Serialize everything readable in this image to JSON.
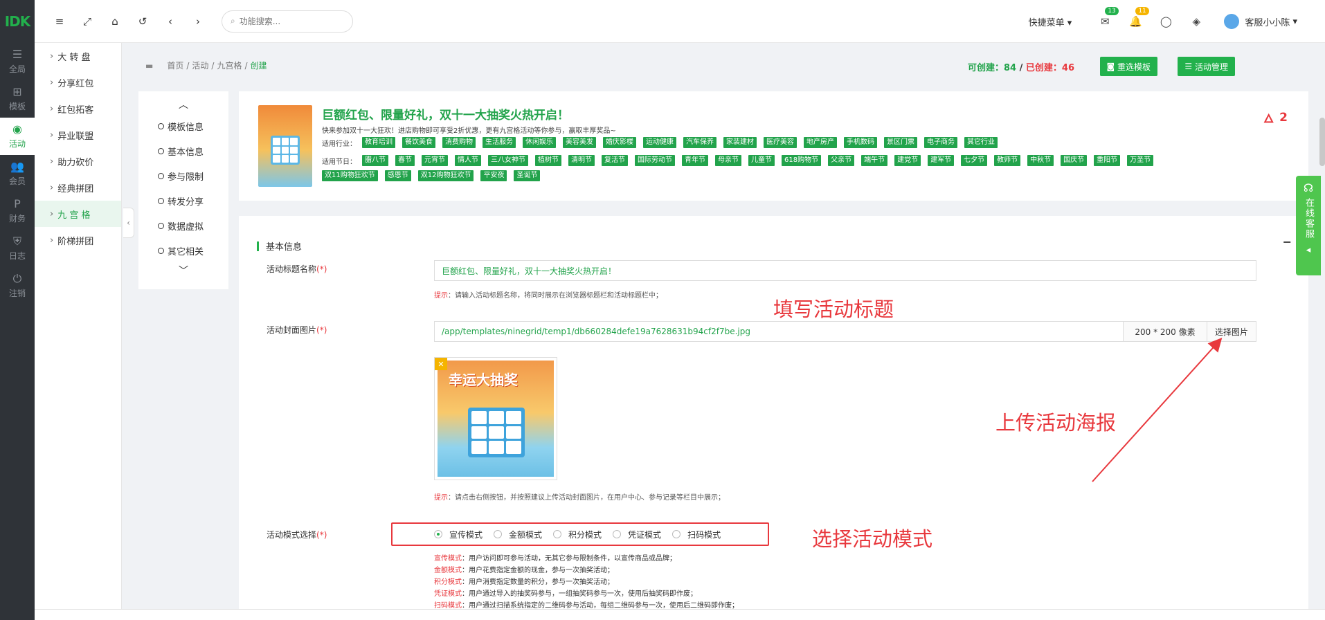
{
  "logo": "IDK",
  "rail": [
    {
      "label": "全局",
      "icon": "sliders-icon"
    },
    {
      "label": "模板",
      "icon": "sitemap-icon"
    },
    {
      "label": "活动",
      "icon": "map-pin-icon",
      "active": true
    },
    {
      "label": "会员",
      "icon": "users-icon"
    },
    {
      "label": "财务",
      "icon": "paypal-icon"
    },
    {
      "label": "日志",
      "icon": "shield-icon"
    },
    {
      "label": "注销",
      "icon": "power-icon"
    }
  ],
  "submenu": [
    "大 转 盘",
    "分享红包",
    "红包拓客",
    "异业联盟",
    "助力砍价",
    "经典拼团",
    "九 宫 格",
    "阶梯拼团"
  ],
  "submenu_active": "九 宫 格",
  "search_placeholder": "功能搜索...",
  "quick_menu": "快捷菜单",
  "mail_badge": "13",
  "bell_badge": "11",
  "username": "客服小小陈",
  "breadcrumb": {
    "home": "首页",
    "activity": "活动",
    "ninegrid": "九宫格",
    "current": "创建"
  },
  "stats": {
    "can_label": "可创建：",
    "can_value": "84",
    "sep": " / ",
    "made_label": "已创建：",
    "made_value": "46"
  },
  "buttons": {
    "reselect": "重选模板",
    "manage": "活动管理"
  },
  "section_nav": [
    "模板信息",
    "基本信息",
    "参与限制",
    "转发分享",
    "数据虚拟",
    "其它相关"
  ],
  "template": {
    "title": "巨额红包、限量好礼，双十一大抽奖火热开启！",
    "desc": "快来参加双十一大狂欢！进店购物即可享受2折优惠，更有九宫格活动等你参与，赢取丰厚奖品~",
    "industry_label": "适用行业：",
    "industries": [
      "教育培训",
      "餐饮美食",
      "消费购物",
      "生活服务",
      "休闲娱乐",
      "美容美发",
      "婚庆影楼",
      "运动健康",
      "汽车保养",
      "家装建材",
      "医疗美容",
      "地产房产",
      "手机数码",
      "景区门票",
      "电子商务",
      "其它行业"
    ],
    "festival_label": "适用节日：",
    "festivals": [
      "腊八节",
      "春节",
      "元宵节",
      "情人节",
      "三八女神节",
      "植树节",
      "清明节",
      "复活节",
      "国际劳动节",
      "青年节",
      "母亲节",
      "儿童节",
      "618购物节",
      "父亲节",
      "端午节",
      "建党节",
      "建军节",
      "七夕节",
      "教师节",
      "中秋节",
      "国庆节",
      "重阳节",
      "万圣节",
      "双11购物狂欢节",
      "感恩节",
      "双12购物狂欢节",
      "平安夜",
      "圣诞节"
    ],
    "likes": "2"
  },
  "form": {
    "section_title": "基本信息",
    "title_label": "活动标题名称",
    "req": "(*)",
    "title_value": "巨额红包、限量好礼，双十一大抽奖火热开启！",
    "hint_key": "提示",
    "title_hint": "：请输入活动标题名称，将同时展示在浏览器标题栏和活动标题栏中；",
    "cover_label": "活动封面图片",
    "cover_value": "/app/templates/ninegrid/temp1/db660284defe19a7628631b94cf2f7be.jpg",
    "cover_size": "200 * 200 像素",
    "cover_btn": "选择图片",
    "cover_img_text": "幸运大抽奖",
    "cover_hint": "：请点击右侧按钮，并按照建议上传活动封面图片，在用户中心、参与记录等栏目中展示；",
    "mode_label": "活动模式选择",
    "modes": [
      "宣传模式",
      "金额模式",
      "积分模式",
      "凭证模式",
      "扫码模式"
    ],
    "mode_selected": "宣传模式",
    "mode_descs": [
      {
        "k": "宣传模式",
        "v": "：用户访问即可参与活动，无其它参与限制条件，以宣传商品或品牌；"
      },
      {
        "k": "金额模式",
        "v": "：用户花费指定金额的现金，参与一次抽奖活动；"
      },
      {
        "k": "积分模式",
        "v": "：用户消费指定数量的积分，参与一次抽奖活动；"
      },
      {
        "k": "凭证模式",
        "v": "：用户通过导入的抽奖码参与，一组抽奖码参与一次，使用后抽奖码即作废；"
      },
      {
        "k": "扫码模式",
        "v": "：用户通过扫描系统指定的二维码参与活动，每组二维码参与一次，使用后二维码即作废；"
      }
    ]
  },
  "annotations": {
    "title": "填写活动标题",
    "poster": "上传活动海报",
    "mode": "选择活动模式"
  },
  "service": "在线客服",
  "colors": {
    "brand": "#22b14c",
    "accent_red": "#e8383d",
    "rail_bg": "#2f3338"
  }
}
